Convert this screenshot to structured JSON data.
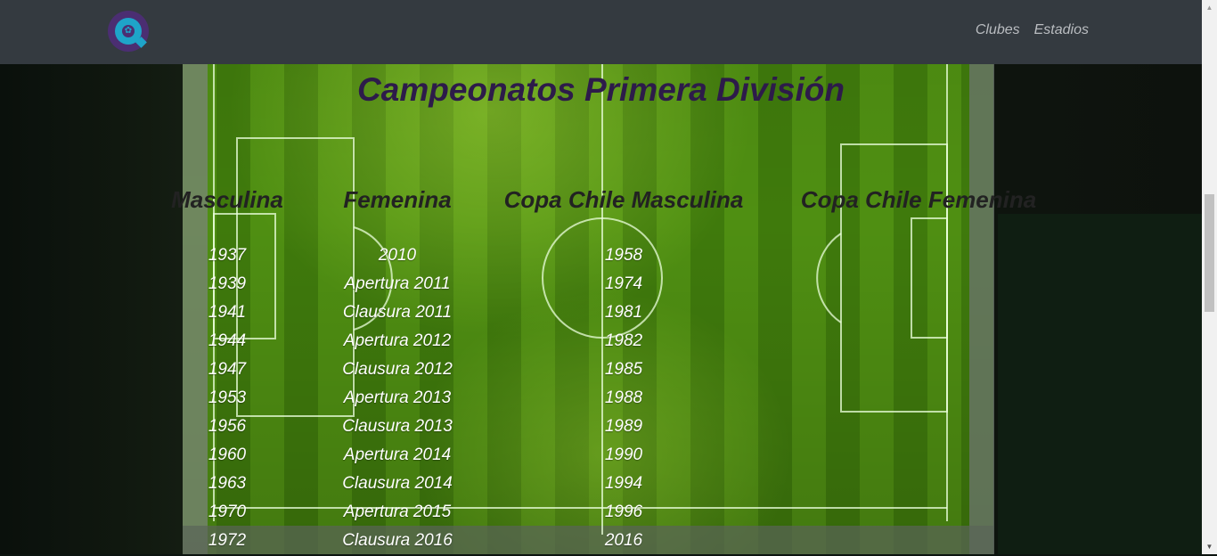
{
  "navbar": {
    "logo_icon": "app-logo-icon",
    "links": [
      "Clubes",
      "Estadios"
    ]
  },
  "page": {
    "title": "Campeonatos Primera División"
  },
  "columns": [
    {
      "header": "Masculina",
      "items": [
        "1937",
        "1939",
        "1941",
        "1944",
        "1947",
        "1953",
        "1956",
        "1960",
        "1963",
        "1970",
        "1972"
      ]
    },
    {
      "header": "Femenina",
      "items": [
        "2010",
        "Apertura 2011",
        "Clausura 2011",
        "Apertura 2012",
        "Clausura 2012",
        "Apertura 2013",
        "Clausura 2013",
        "Apertura 2014",
        "Clausura 2014",
        "Apertura 2015",
        "Clausura 2016"
      ]
    },
    {
      "header": "Copa Chile Masculina",
      "items": [
        "1958",
        "1974",
        "1981",
        "1982",
        "1985",
        "1988",
        "1989",
        "1990",
        "1994",
        "1996",
        "2016"
      ]
    },
    {
      "header": "Copa Chile Femenina",
      "items": []
    }
  ],
  "colors": {
    "navbar": "#343a40",
    "title": "#2d1b4a",
    "logo_outer": "#4b2e72",
    "logo_inner": "#1ea4c9"
  }
}
